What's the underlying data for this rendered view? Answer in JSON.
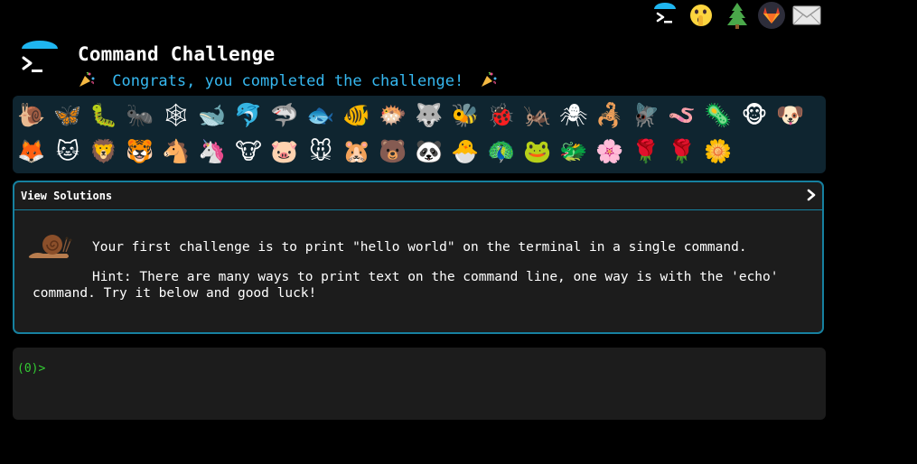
{
  "nav": {
    "icons": [
      "terminal-icon",
      "shushing-face-icon",
      "evergreen-tree-icon",
      "gitlab-icon",
      "envelope-icon"
    ]
  },
  "header": {
    "title": "Command Challenge",
    "subtitle": "Congrats, you completed the challenge!"
  },
  "colors": {
    "background": "#000000",
    "subtitle": "#36b8f0",
    "panel_border": "#16809f",
    "panel_bg": "#1c1c1c",
    "strip_bg": "#0f2530",
    "prompt": "#33cc33"
  },
  "challenges": {
    "row1": [
      {
        "name": "snail",
        "glyph": "🐌"
      },
      {
        "name": "butterfly",
        "glyph": "🦋"
      },
      {
        "name": "caterpillar",
        "glyph": "🐛"
      },
      {
        "name": "ant",
        "glyph": "🐜"
      },
      {
        "name": "spider-web",
        "glyph": "🕸"
      },
      {
        "name": "whale",
        "glyph": "🐋"
      },
      {
        "name": "dolphin",
        "glyph": "🐬"
      },
      {
        "name": "shark",
        "glyph": "🦈"
      },
      {
        "name": "fish",
        "glyph": "🐟"
      },
      {
        "name": "tropical-fish",
        "glyph": "🐠"
      },
      {
        "name": "blowfish",
        "glyph": "🐡"
      },
      {
        "name": "wolf",
        "glyph": "🐺"
      },
      {
        "name": "bee",
        "glyph": "🐝"
      },
      {
        "name": "ladybug",
        "glyph": "🐞"
      },
      {
        "name": "cricket",
        "glyph": "🦗"
      },
      {
        "name": "spider",
        "glyph": "🕷"
      },
      {
        "name": "scorpion",
        "glyph": "🦂"
      },
      {
        "name": "fly",
        "glyph": "🪰"
      },
      {
        "name": "worm",
        "glyph": "🪱"
      },
      {
        "name": "microbe",
        "glyph": "🦠"
      },
      {
        "name": "monkey",
        "glyph": "🐵"
      },
      {
        "name": "dog",
        "glyph": "🐶"
      }
    ],
    "row2": [
      {
        "name": "fox",
        "glyph": "🦊"
      },
      {
        "name": "cat",
        "glyph": "🐱"
      },
      {
        "name": "lion",
        "glyph": "🦁"
      },
      {
        "name": "tiger",
        "glyph": "🐯"
      },
      {
        "name": "horse",
        "glyph": "🐴"
      },
      {
        "name": "unicorn",
        "glyph": "🦄"
      },
      {
        "name": "cow",
        "glyph": "🐮"
      },
      {
        "name": "pig",
        "glyph": "🐷"
      },
      {
        "name": "mouse",
        "glyph": "🐭"
      },
      {
        "name": "hamster",
        "glyph": "🐹"
      },
      {
        "name": "bear",
        "glyph": "🐻"
      },
      {
        "name": "panda",
        "glyph": "🐼"
      },
      {
        "name": "hatching-chick",
        "glyph": "🐣"
      },
      {
        "name": "peacock",
        "glyph": "🦚"
      },
      {
        "name": "frog",
        "glyph": "🐸"
      },
      {
        "name": "dragon",
        "glyph": "🐲"
      },
      {
        "name": "cherry-blossom",
        "glyph": "🌸"
      },
      {
        "name": "rose",
        "glyph": "🌹"
      },
      {
        "name": "rose-small",
        "glyph": "🌹"
      },
      {
        "name": "blossom",
        "glyph": "🌼"
      }
    ]
  },
  "panel": {
    "header_label": "View Solutions",
    "challenge": "Your first challenge is to print \"hello world\" on the terminal in a single command.",
    "hint_line1": "Hint: There are many ways to print text on the command line, one way is with the 'echo'",
    "hint_line2": "command. Try it below and good luck!"
  },
  "terminal": {
    "prompt": "(0)>"
  }
}
